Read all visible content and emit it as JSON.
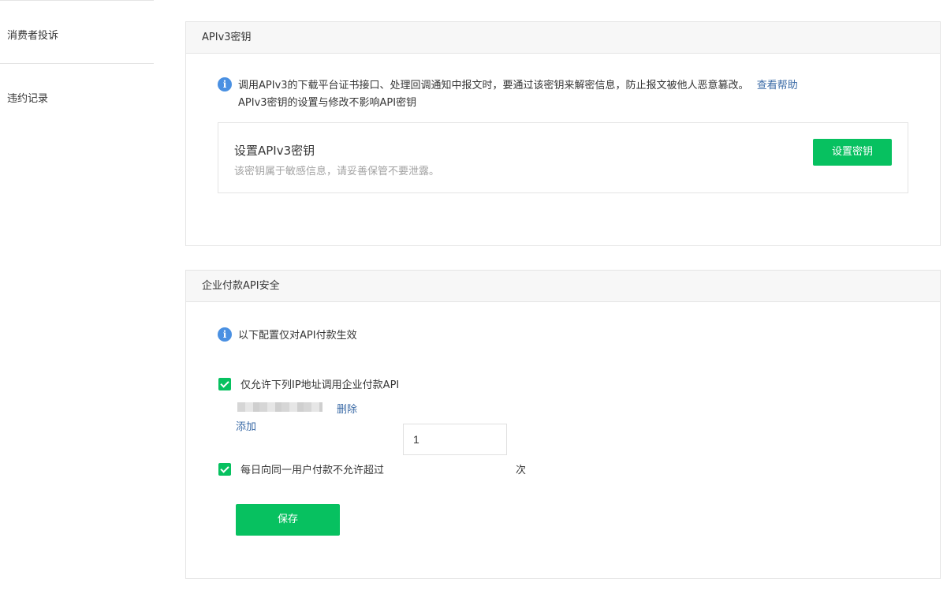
{
  "sidebar": {
    "items": [
      {
        "label": "消费者投诉"
      },
      {
        "label": "违约记录"
      }
    ]
  },
  "apiv3_panel": {
    "title": "APIv3密钥",
    "info_line1": "调用APIv3的下载平台证书接口、处理回调通知中报文时，要通过该密钥来解密信息，防止报文被他人恶意篡改。",
    "help_link": "查看帮助",
    "info_line2": "APIv3密钥的设置与修改不影响API密钥",
    "box_title": "设置APIv3密钥",
    "box_desc": "该密钥属于敏感信息，请妥善保管不要泄露。",
    "set_button": "设置密钥"
  },
  "payment_panel": {
    "title": "企业付款API安全",
    "info": "以下配置仅对API付款生效",
    "ip_check_label": "仅允许下列IP地址调用企业付款API",
    "delete_link": "删除",
    "add_link": "添加",
    "limit_label": "每日向同一用户付款不允许超过",
    "limit_value": "1",
    "limit_unit": "次",
    "save_button": "保存"
  },
  "colors": {
    "accent_green": "#07c160",
    "info_blue": "#4a90e2",
    "link_blue": "#3a6aa6"
  }
}
